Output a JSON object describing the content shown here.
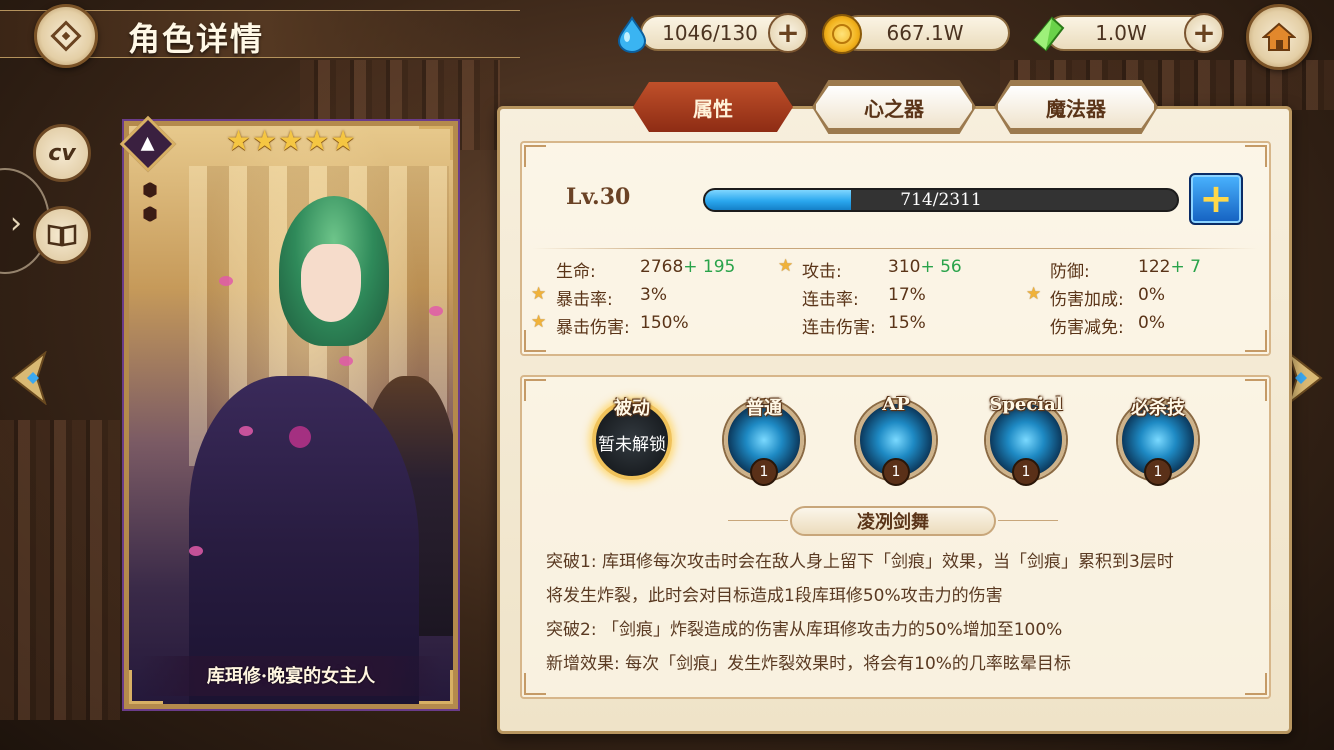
{
  "header": {
    "title": "角色详情",
    "resources": [
      {
        "icon": "water-drop-icon",
        "value": "1046/130"
      },
      {
        "icon": "gold-coin-icon",
        "value": "667.1W"
      },
      {
        "icon": "green-crystal-icon",
        "value": "1.0W"
      }
    ]
  },
  "side": {
    "cv_label": "cv"
  },
  "card": {
    "name": "库珥修·晚宴的女主人",
    "stars": 5
  },
  "tabs": [
    {
      "label": "属性",
      "active": true
    },
    {
      "label": "心之器",
      "active": false
    },
    {
      "label": "魔法器",
      "active": false
    }
  ],
  "level": {
    "label": "Lv.30",
    "exp_text": "714/2311",
    "exp_fraction": 0.309
  },
  "stats": {
    "hp_label": "生命:",
    "hp_value": "2768",
    "hp_bonus": "+ 195",
    "atk_label": "攻击:",
    "atk_value": "310",
    "atk_bonus": "+ 56",
    "def_label": "防御:",
    "def_value": "122",
    "def_bonus": "+ 7",
    "crit_rate_label": "暴击率:",
    "crit_rate_value": "3%",
    "combo_rate_label": "连击率:",
    "combo_rate_value": "17%",
    "dmg_bonus_label": "伤害加成:",
    "dmg_bonus_value": "0%",
    "crit_dmg_label": "暴击伤害:",
    "crit_dmg_value": "150%",
    "combo_dmg_label": "连击伤害:",
    "combo_dmg_value": "15%",
    "dmg_reduce_label": "伤害减免:",
    "dmg_reduce_value": "0%"
  },
  "skills": [
    {
      "name": "被动",
      "locked_text": "暂未解锁",
      "level": ""
    },
    {
      "name": "普通",
      "level": "1"
    },
    {
      "name": "AP",
      "level": "1"
    },
    {
      "name": "Special",
      "level": "1"
    },
    {
      "name": "必杀技",
      "level": "1"
    }
  ],
  "skill_detail": {
    "name": "凌冽剑舞",
    "lines": [
      "突破1: 库珥修每次攻击时会在敌人身上留下「剑痕」效果，当「剑痕」累积到3层时",
      "将发生炸裂，此时会对目标造成1段库珥修50%攻击力的伤害",
      "突破2: 「剑痕」炸裂造成的伤害从库珥修攻击力的50%增加至100%",
      "新增效果: 每次「剑痕」发生炸裂效果时，将会有10%的几率眩晕目标"
    ]
  }
}
